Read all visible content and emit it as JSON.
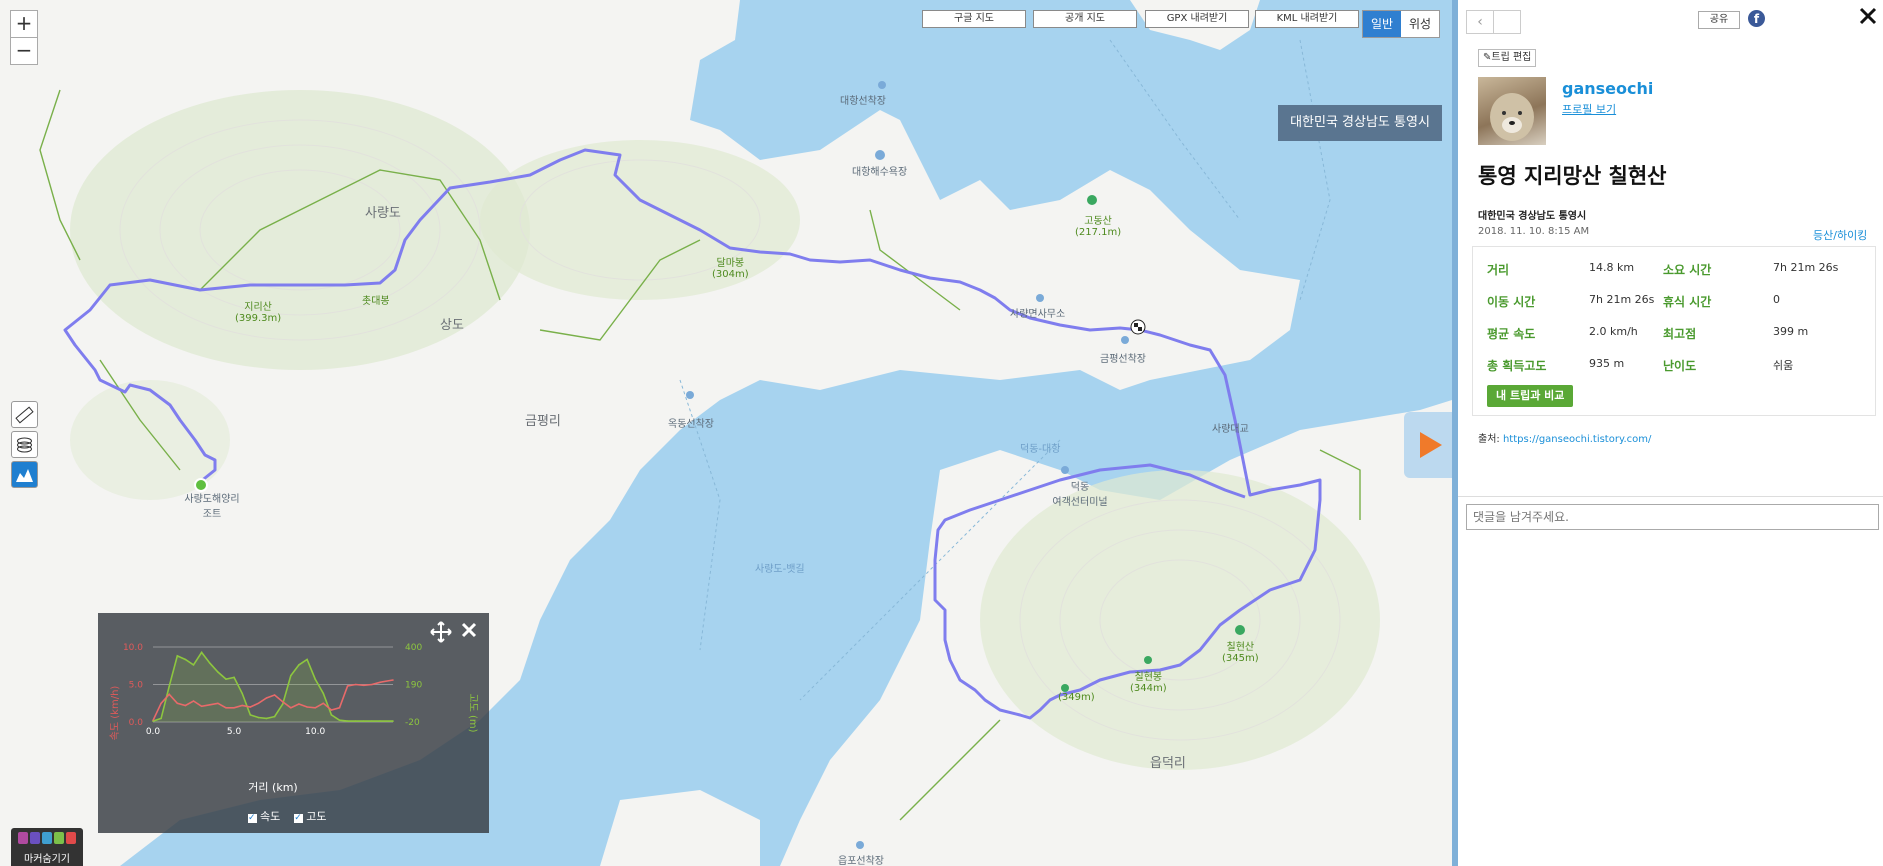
{
  "map": {
    "type_buttons": {
      "google": "구글 지도",
      "public": "공개 지도",
      "gpx": "GPX 내려받기",
      "kml": "KML 내려받기"
    },
    "view_toggle": {
      "normal": "일반",
      "satellite": "위성"
    },
    "zoom": {
      "in": "+",
      "out": "−"
    },
    "region_badge": "대한민국 경상남도 통영시",
    "labels": {
      "saryangdo": "사량도",
      "sangdo": "상도",
      "geumpyeongri": "금평리",
      "eupdeokri": "읍덕리",
      "jirisan": "지리산",
      "jirisan_alt": "(399.3m)",
      "chodaebong": "촛대봉",
      "dalmabong": "달마봉",
      "dalmabong_alt": "(304m)",
      "godongsan": "고동산",
      "godongsan_alt": "(217.1m)",
      "chilhyeonsan": "칠현산",
      "chilhyeonsan_alt": "(345m)",
      "chilhyeonbong": "칠현봉",
      "chilhyeonbong_alt": "(344m)",
      "peak349": "(349m)",
      "daehang_port": "대항선착장",
      "daehang_beach": "대항해수욕장",
      "office": "사량면사무소",
      "geumpyeong_port": "금평선착장",
      "oknong_port": "옥동선착장",
      "resort": "사량도해양리조트",
      "saryang_bridge": "사량대교",
      "deokdong_terminal": "덕동\n여객선터미널",
      "eupo_port": "읍포선착장",
      "route1": "덕동-대항",
      "route2": "사량도-뱃길"
    },
    "icons": [
      "ruler-icon",
      "layers-icon",
      "elevation-icon"
    ],
    "marker_toggle": "마커숨기기",
    "chart": {
      "left_axis": "속도 (km/h)",
      "right_axis": "고도 (m)",
      "xlabel": "거리 (km)",
      "legend_speed": "속도",
      "legend_alt": "고도",
      "speed_ticks": [
        "10.0",
        "5.0",
        "0.0"
      ],
      "alt_ticks": [
        "400",
        "190",
        "-20"
      ],
      "x_ticks": [
        "0.0",
        "5.0",
        "10.0"
      ]
    }
  },
  "chart_data": {
    "type": "line",
    "xlabel": "거리 (km)",
    "ylabel": "속도 (km/h)",
    "y2label": "고도 (m)",
    "xlim": [
      0,
      14.8
    ],
    "ylim": [
      0,
      10
    ],
    "y2lim": [
      -20,
      400
    ],
    "series": [
      {
        "name": "속도",
        "color": "#e05a5a",
        "axis": "left",
        "x": [
          0,
          0.5,
          1.0,
          1.5,
          2.0,
          2.5,
          3.0,
          3.5,
          4.0,
          4.5,
          5.0,
          5.5,
          6.0,
          6.5,
          7.0,
          7.5,
          8.0,
          8.5,
          9.0,
          9.5,
          10.0,
          10.5,
          11.0,
          11.5,
          12.0,
          12.5,
          13.0,
          13.5,
          14.0,
          14.8
        ],
        "y": [
          0.2,
          2.5,
          3.7,
          2.5,
          2.2,
          2.8,
          2.1,
          2.3,
          2.5,
          1.9,
          1.9,
          2.2,
          2.0,
          2.5,
          3.2,
          3.6,
          2.7,
          1.9,
          2.4,
          2.0,
          1.9,
          2.5,
          1.6,
          1.9,
          4.8,
          5.0,
          4.9,
          5.0,
          5.3,
          5.6
        ]
      },
      {
        "name": "고도",
        "color": "#8dc63f",
        "axis": "right",
        "x": [
          0,
          0.5,
          1.0,
          1.5,
          2.0,
          2.5,
          3.0,
          3.5,
          4.0,
          4.5,
          5.0,
          5.5,
          6.0,
          6.5,
          7.0,
          7.5,
          8.0,
          8.5,
          9.0,
          9.5,
          10.0,
          10.5,
          11.0,
          11.5,
          12.0,
          12.5,
          13.0,
          13.5,
          14.0,
          14.8
        ],
        "y": [
          -15,
          0,
          180,
          350,
          330,
          300,
          370,
          310,
          260,
          220,
          230,
          140,
          20,
          5,
          0,
          10,
          80,
          240,
          300,
          330,
          220,
          140,
          20,
          -10,
          -15,
          -15,
          -15,
          -15,
          -15,
          -15
        ]
      }
    ]
  },
  "panel": {
    "share": "공유",
    "edit_trip": "트립 편집",
    "user": "ganseochi",
    "profile_link": "프로필 보기",
    "title": "통영 지리망산 칠현산",
    "region": "대한민국 경상남도 통영시",
    "datetime": "2018. 11. 10. 8:15 AM",
    "activity": "등산/하이킹",
    "stats": [
      {
        "k": "거리",
        "v": "14.8 km",
        "k2": "소요 시간",
        "v2": "7h 21m 26s"
      },
      {
        "k": "이동 시간",
        "v": "7h 21m 26s",
        "k2": "휴식 시간",
        "v2": "0"
      },
      {
        "k": "평균 속도",
        "v": "2.0 km/h",
        "k2": "최고점",
        "v2": "399 m"
      },
      {
        "k": "총 획득고도",
        "v": "935 m",
        "k2": "난이도",
        "v2": "쉬움"
      }
    ],
    "compare_button": "내 트립과 비교",
    "source_label": "출처:",
    "source_url": "https://ganseochi.tistory.com/",
    "comment_placeholder": "댓글을 남겨주세요."
  }
}
